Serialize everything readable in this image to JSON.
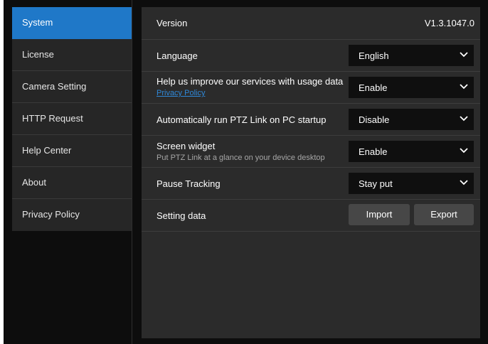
{
  "sidebar": {
    "items": [
      {
        "label": "System"
      },
      {
        "label": "License"
      },
      {
        "label": "Camera Setting"
      },
      {
        "label": "HTTP Request"
      },
      {
        "label": "Help Center"
      },
      {
        "label": "About"
      },
      {
        "label": "Privacy Policy"
      }
    ],
    "active": "System"
  },
  "system": {
    "version": {
      "label": "Version",
      "value": "V1.3.1047.0"
    },
    "language": {
      "label": "Language",
      "selected": "English"
    },
    "usage_data": {
      "label": "Help us improve our services with usage data",
      "link": "Privacy Policy",
      "selected": "Enable"
    },
    "autorun": {
      "label": "Automatically run PTZ Link on PC startup",
      "selected": "Disable"
    },
    "screen_widget": {
      "label": "Screen widget",
      "description": "Put PTZ Link at a glance on your device desktop",
      "selected": "Enable"
    },
    "pause_tracking": {
      "label": "Pause Tracking",
      "selected": "Stay put"
    },
    "setting_data": {
      "label": "Setting data",
      "import_label": "Import",
      "export_label": "Export"
    }
  },
  "colors": {
    "accent": "#1f78c8",
    "link": "#2f88d8",
    "panel_bg": "#2b2b2b",
    "sidebar_bg": "#262626",
    "select_bg": "#0f0f0f"
  },
  "icons": {
    "dropdown": "chevron-down-icon"
  }
}
